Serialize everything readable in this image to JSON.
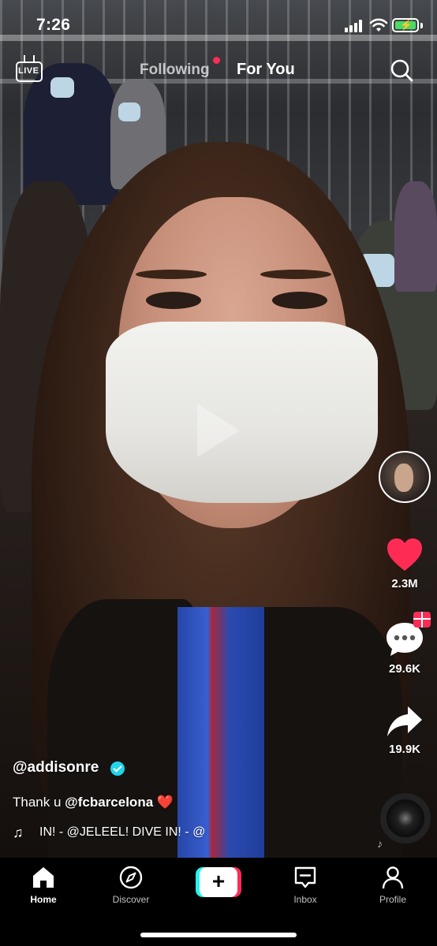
{
  "status_bar": {
    "time": "7:26",
    "battery_color": "#4cd964"
  },
  "top_nav": {
    "live_label": "LIVE",
    "tab_following": "Following",
    "tab_for_you": "For You",
    "notification_dot_color": "#fe2c55",
    "search_icon": "search-icon"
  },
  "actions": {
    "likes": "2.3M",
    "comments": "29.6K",
    "shares": "19.9K",
    "like_color": "#fe2c55"
  },
  "caption": {
    "username": "@addisonre",
    "text_prefix": "Thank u ",
    "mention": "@fcbarcelona",
    "emoji": "❤️",
    "sound": "IN! - @JELEEL!    DIVE IN! - @"
  },
  "tab_bar": {
    "home": "Home",
    "discover": "Discover",
    "create": "+",
    "inbox": "Inbox",
    "profile": "Profile"
  }
}
